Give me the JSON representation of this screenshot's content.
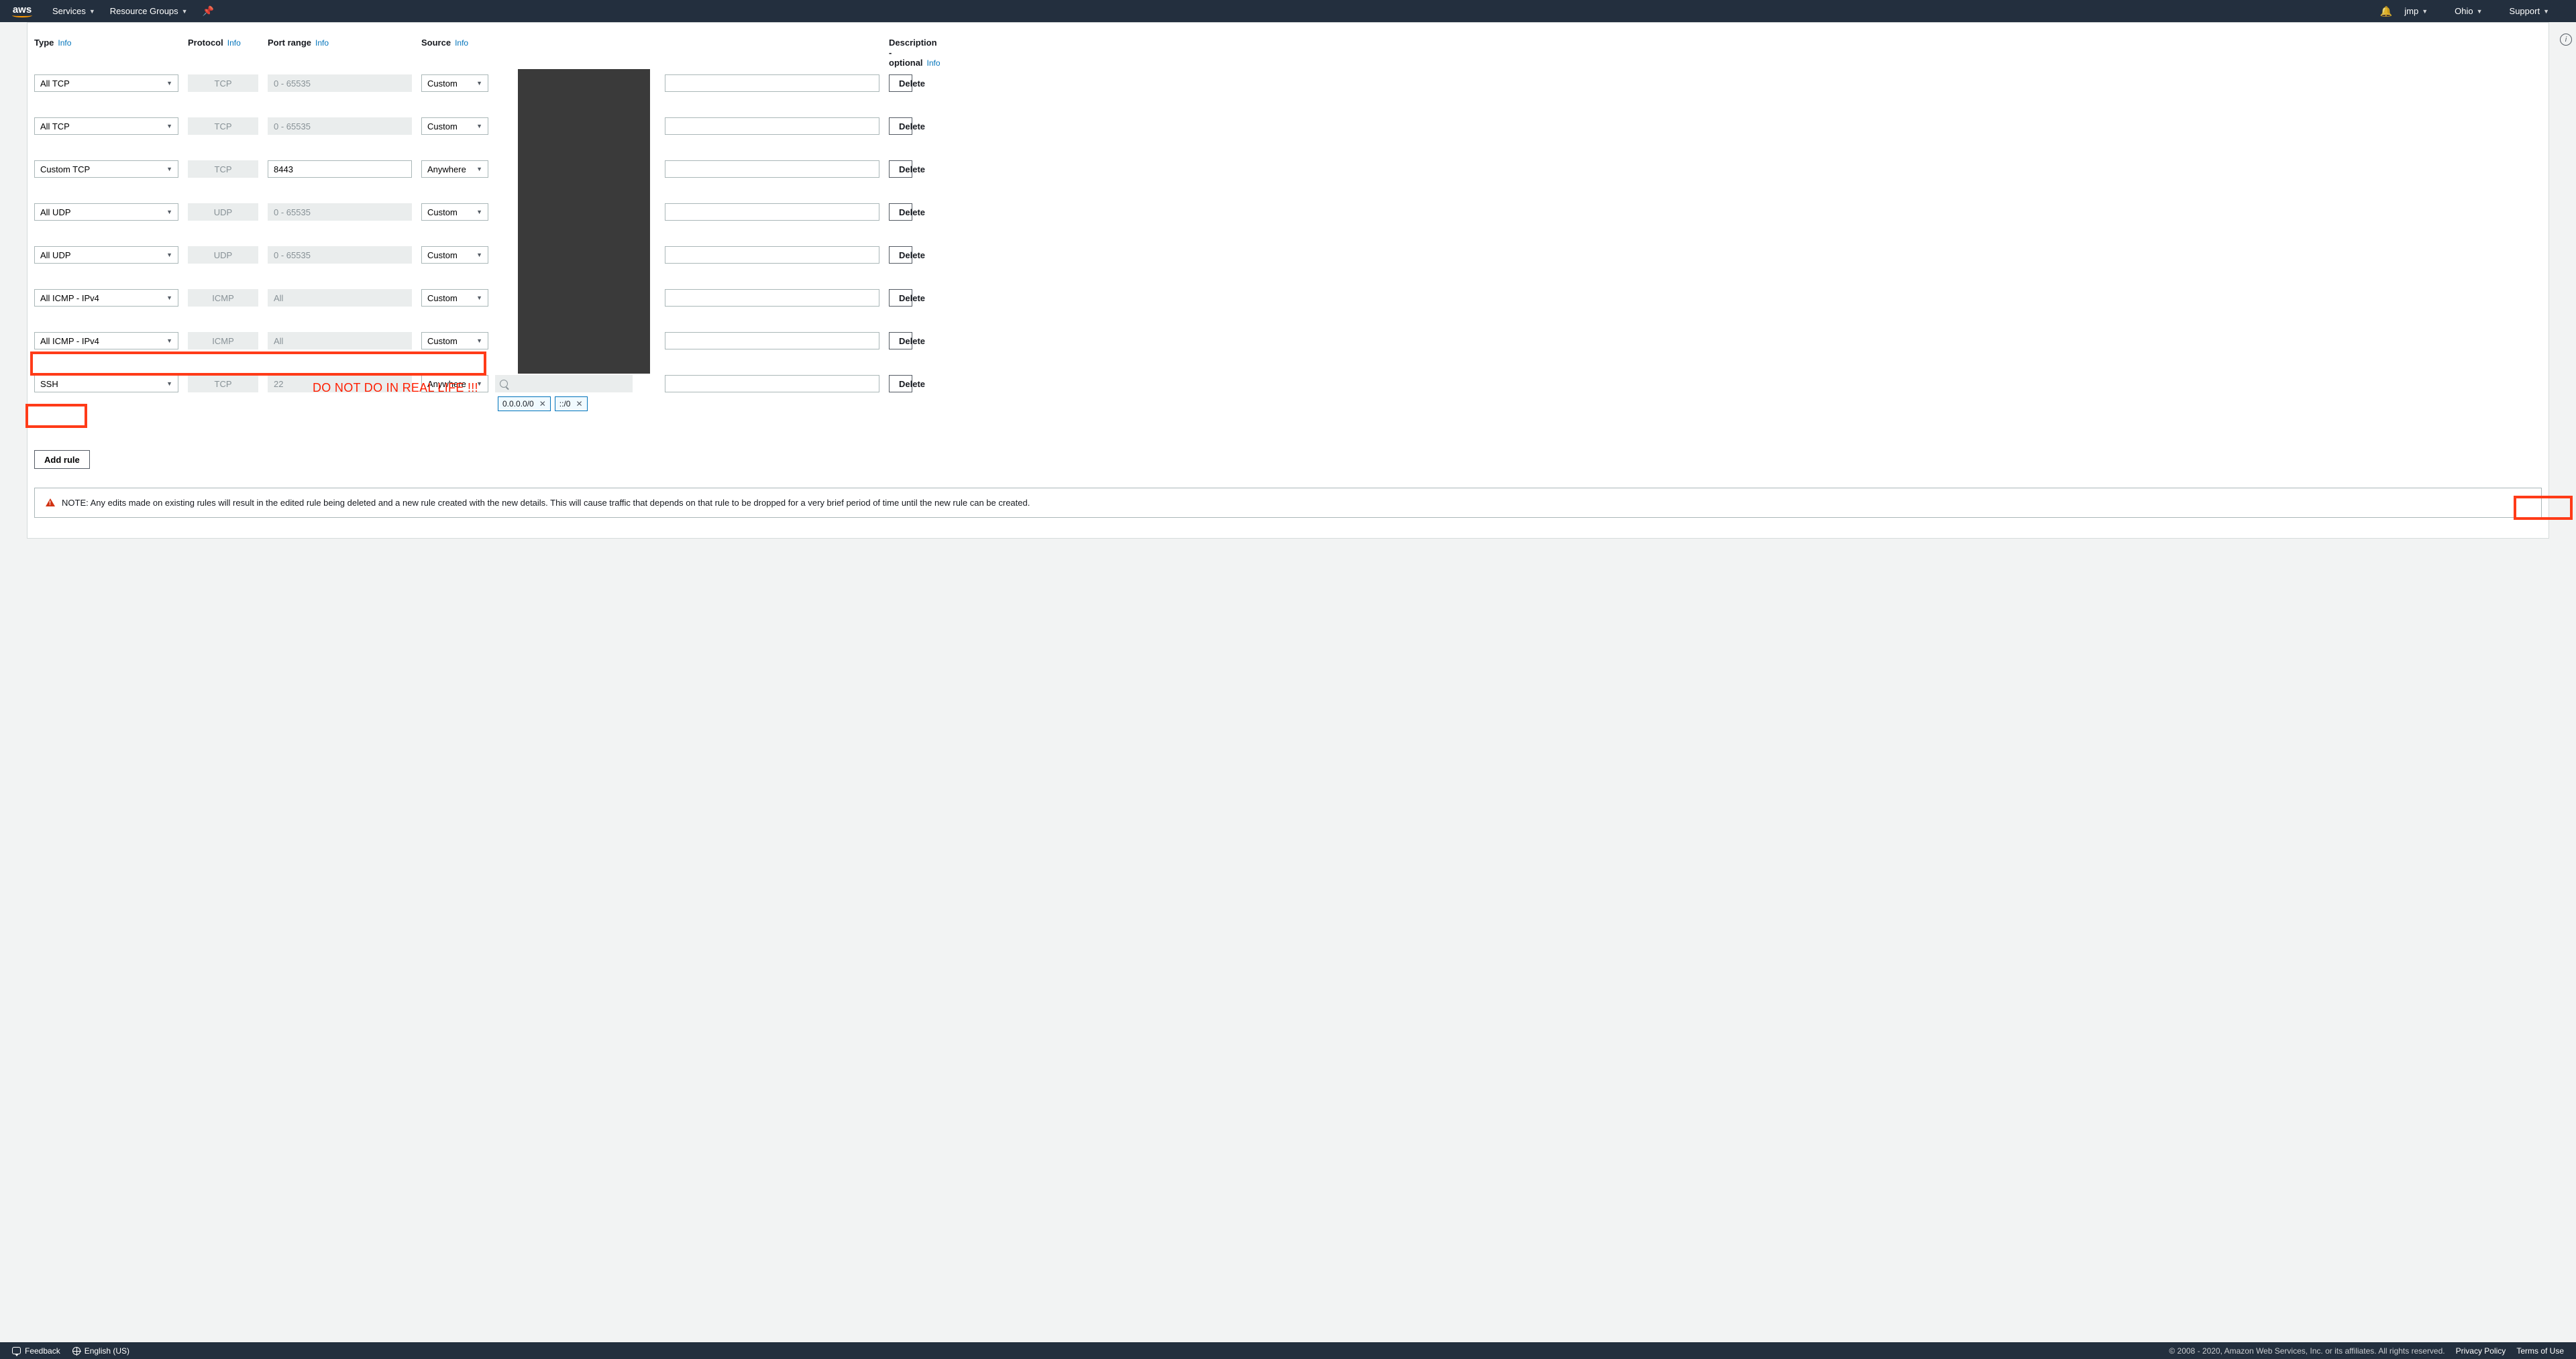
{
  "nav": {
    "logo": "aws",
    "services": "Services",
    "resource_groups": "Resource Groups",
    "user": "jmp",
    "region": "Ohio",
    "support": "Support"
  },
  "headers": {
    "type": "Type",
    "protocol": "Protocol",
    "port": "Port range",
    "source": "Source",
    "description": "Description - optional",
    "info": "Info"
  },
  "rules": [
    {
      "type": "All TCP",
      "protocol": "TCP",
      "port": "0 - 65535",
      "port_editable": false,
      "source": "Custom",
      "search_visible": false
    },
    {
      "type": "All TCP",
      "protocol": "TCP",
      "port": "0 - 65535",
      "port_editable": false,
      "source": "Custom",
      "search_visible": false
    },
    {
      "type": "Custom TCP",
      "protocol": "TCP",
      "port": "8443",
      "port_editable": true,
      "source": "Anywhere",
      "search_visible": false
    },
    {
      "type": "All UDP",
      "protocol": "UDP",
      "port": "0 - 65535",
      "port_editable": false,
      "source": "Custom",
      "search_visible": false
    },
    {
      "type": "All UDP",
      "protocol": "UDP",
      "port": "0 - 65535",
      "port_editable": false,
      "source": "Custom",
      "search_visible": false
    },
    {
      "type": "All ICMP - IPv4",
      "protocol": "ICMP",
      "port": "All",
      "port_editable": false,
      "source": "Custom",
      "search_visible": false
    },
    {
      "type": "All ICMP - IPv4",
      "protocol": "ICMP",
      "port": "All",
      "port_editable": false,
      "source": "Custom",
      "search_visible": false
    },
    {
      "type": "SSH",
      "protocol": "TCP",
      "port": "22",
      "port_editable": false,
      "source": "Anywhere",
      "search_visible": true,
      "chips": [
        "0.0.0.0/0",
        "::/0"
      ]
    }
  ],
  "buttons": {
    "delete": "Delete",
    "add_rule": "Add rule"
  },
  "note": "NOTE: Any edits made on existing rules will result in the edited rule being deleted and a new rule created with the new details. This will cause traffic that depends on that rule to be dropped for a very brief period of time until the new rule can be created.",
  "annotation": "DO NOT DO IN REAL LIFE !!!",
  "footer": {
    "feedback": "Feedback",
    "language": "English (US)",
    "copyright": "© 2008 - 2020, Amazon Web Services, Inc. or its affiliates. All rights reserved.",
    "privacy": "Privacy Policy",
    "terms": "Terms of Use"
  }
}
